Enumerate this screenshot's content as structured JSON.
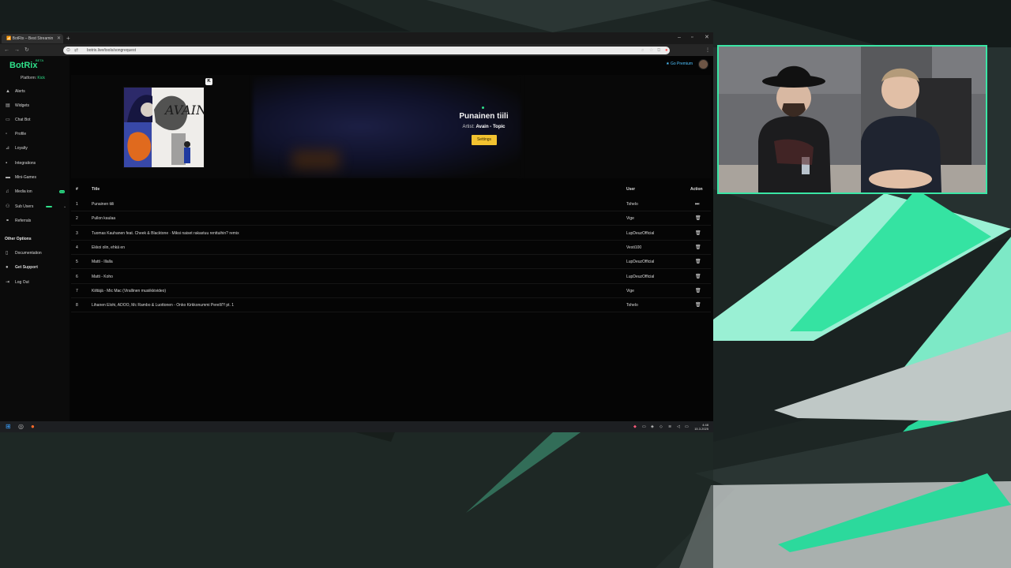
{
  "browser": {
    "tab_title": "📶 BotRix – Best Streamin",
    "url": "botrix.live/tools/songrequest"
  },
  "sidebar": {
    "brand": "BotRix",
    "beta": "BETA",
    "platform_label": "Platform:",
    "platform_value": "Kick",
    "items": [
      {
        "label": "Alerts",
        "icon": "bell-icon"
      },
      {
        "label": "Widgets",
        "icon": "widget-icon"
      },
      {
        "label": "Chat Bot",
        "icon": "chat-icon"
      },
      {
        "label": "Profile",
        "icon": "user-icon"
      },
      {
        "label": "Loyalty",
        "icon": "loyalty-icon"
      },
      {
        "label": "Integrations",
        "icon": "integrations-icon"
      },
      {
        "label": "Mini-Games",
        "icon": "gamepad-icon"
      },
      {
        "label": "Media ion",
        "icon": "music-note-icon",
        "badge": "new"
      },
      {
        "label": "Sub Users",
        "icon": "users-icon"
      },
      {
        "label": "Referrals",
        "icon": "link-icon"
      }
    ],
    "other_heading": "Other Options",
    "other_items": [
      {
        "label": "Documentation",
        "icon": "doc-icon"
      },
      {
        "label": "Get Support",
        "icon": "support-icon"
      },
      {
        "label": "Log Out",
        "icon": "logout-icon"
      }
    ]
  },
  "header": {
    "premium_label": "Go Premium"
  },
  "now_playing": {
    "title": "Punainen tiili",
    "artist_label": "Artist:",
    "artist_value": "Avain - Topic",
    "settings_label": "Settings",
    "album_text": "AVAIN"
  },
  "queue": {
    "columns": {
      "num": "#",
      "title": "Title",
      "user": "User",
      "action": "Action"
    },
    "rows": [
      {
        "num": "1",
        "title": "Punainen tiili",
        "user": "Tohelo",
        "action": "play"
      },
      {
        "num": "2",
        "title": "Pullon kaulaa",
        "user": "Vige",
        "action": "delete"
      },
      {
        "num": "3",
        "title": "Tuomas Kauhanen feat. Cheek & Blacktone · Miksi naiset rakastuu renttuihin? remix",
        "user": "LupDeuzOfficial",
        "action": "delete"
      },
      {
        "num": "4",
        "title": "Ekkoi olin, ehkä en",
        "user": "Vesti100",
        "action": "delete"
      },
      {
        "num": "5",
        "title": "Matti - Illalla",
        "user": "LupDeuzOfficial",
        "action": "delete"
      },
      {
        "num": "6",
        "title": "Matti - Koho",
        "user": "LupDeuzOfficial",
        "action": "delete"
      },
      {
        "num": "7",
        "title": "Kiiltäjä - Mic Mac (Virallinen musiikkivideo)",
        "user": "Vige",
        "action": "delete"
      },
      {
        "num": "8",
        "title": "Lihanen Elohi, ADOO, Mc Rambo & Luottonen - Onko Kirkkonummi Perelli?! pt. 1",
        "user": "Tohelo",
        "action": "delete"
      }
    ]
  },
  "taskbar": {
    "time": "4:48",
    "date": "15.3.2025"
  },
  "colors": {
    "accent": "#2fe08a",
    "settings_button": "#f2c230",
    "webcam_border": "#3ae6a5"
  }
}
